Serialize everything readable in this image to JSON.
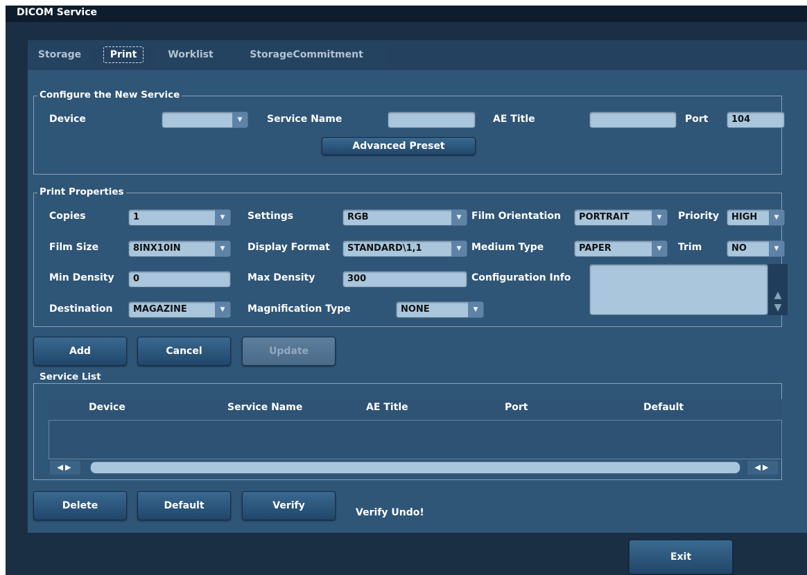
{
  "window": {
    "title": "DICOM Service"
  },
  "tabs": [
    {
      "label": "Storage",
      "active": false
    },
    {
      "label": "Print",
      "active": true
    },
    {
      "label": "Worklist",
      "active": false
    },
    {
      "label": "StorageCommitment",
      "active": false
    }
  ],
  "configure": {
    "legend": "Configure the New Service",
    "device_label": "Device",
    "device_value": "",
    "service_name_label": "Service Name",
    "service_name_value": "",
    "ae_title_label": "AE Title",
    "ae_title_value": "",
    "port_label": "Port",
    "port_value": "104",
    "advanced_preset_label": "Advanced Preset"
  },
  "print_properties": {
    "legend": "Print Properties",
    "copies_label": "Copies",
    "copies_value": "1",
    "settings_label": "Settings",
    "settings_value": "RGB",
    "film_orientation_label": "Film Orientation",
    "film_orientation_value": "PORTRAIT",
    "priority_label": "Priority",
    "priority_value": "HIGH",
    "film_size_label": "Film Size",
    "film_size_value": "8INX10IN",
    "display_format_label": "Display Format",
    "display_format_value": "STANDARD\\1,1",
    "medium_type_label": "Medium Type",
    "medium_type_value": "PAPER",
    "trim_label": "Trim",
    "trim_value": "NO",
    "min_density_label": "Min Density",
    "min_density_value": "0",
    "max_density_label": "Max Density",
    "max_density_value": "300",
    "config_info_label": "Configuration Info",
    "config_info_value": "",
    "destination_label": "Destination",
    "destination_value": "MAGAZINE",
    "magnification_label": "Magnification Type",
    "magnification_value": "NONE"
  },
  "actions": {
    "add": "Add",
    "cancel": "Cancel",
    "update": "Update"
  },
  "service_list": {
    "legend": "Service List",
    "columns": [
      "Device",
      "Service Name",
      "AE Title",
      "Port",
      "Default"
    ]
  },
  "list_actions": {
    "delete": "Delete",
    "default": "Default",
    "verify": "Verify",
    "status": "Verify Undo!"
  },
  "exit_label": "Exit",
  "icons": {
    "dropdown": "chevron-down-icon",
    "scroll_left_right": "arrow-left-right-icon",
    "scroll_up": "arrow-up-icon",
    "scroll_down": "arrow-down-icon"
  },
  "colors": {
    "window_bg": "#1b2f44",
    "panel_bg": "#2f5577",
    "field_bg": "#a9c6dc",
    "button_bg": "#2b557a"
  }
}
